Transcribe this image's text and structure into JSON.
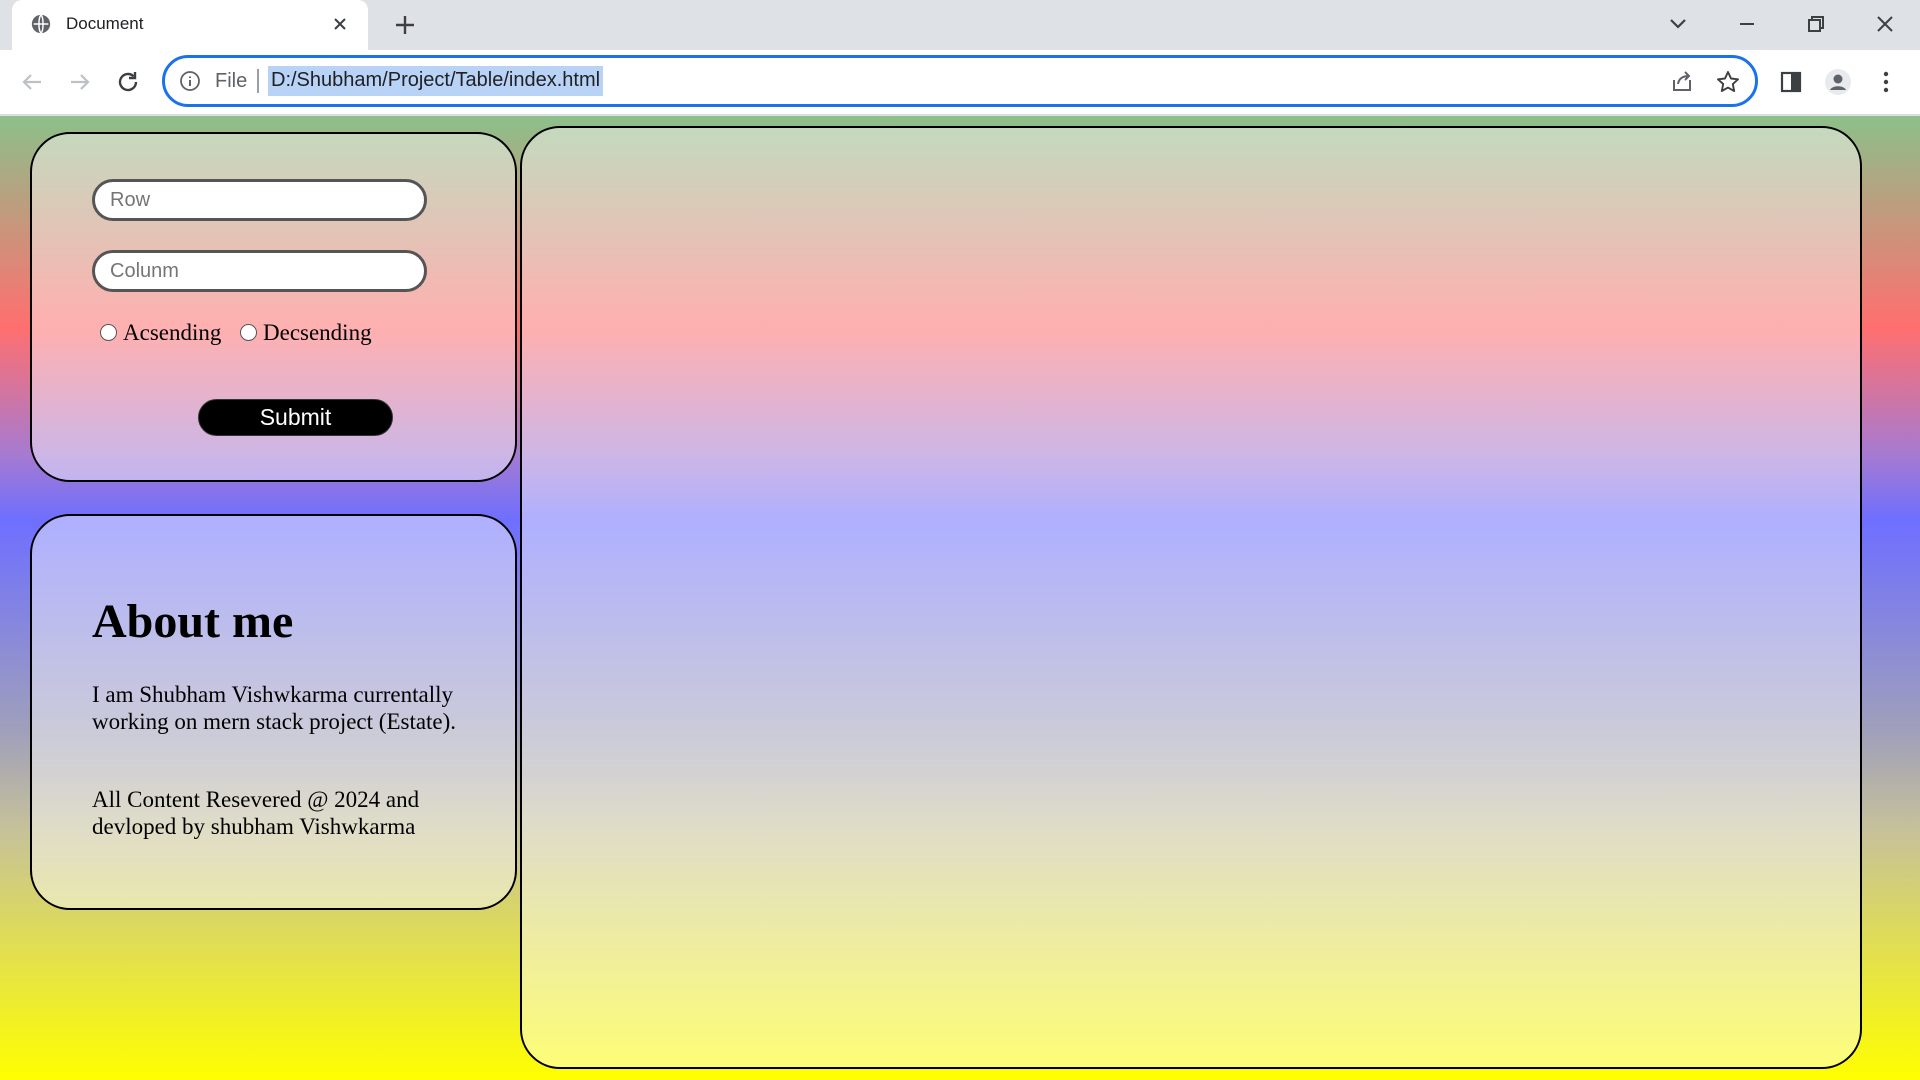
{
  "browser": {
    "tab_title": "Document",
    "address_prefix": "File",
    "url": "D:/Shubham/Project/Table/index.html"
  },
  "colors": {
    "omnibox_focus": "#1a73e8",
    "page_gradient": [
      "#8cc08a",
      "#ff6f6f",
      "#a77ad0",
      "#6e6fff",
      "#a0a0ba",
      "#c6c19a",
      "#ffff00"
    ]
  },
  "icons": {
    "tab_favicon": "globe-icon",
    "tab_close": "close-icon",
    "new_tab": "plus-icon",
    "tab_search": "chevron-down-icon",
    "minimize": "minimize-icon",
    "restore": "restore-icon",
    "close_window": "close-icon",
    "back": "back-arrow-icon",
    "forward": "forward-arrow-icon",
    "reload": "reload-icon",
    "site_info": "info-icon",
    "share": "share-icon",
    "bookmark": "star-icon",
    "side_panel": "side-panel-icon",
    "profile": "profile-icon",
    "menu": "kebab-menu-icon"
  },
  "form": {
    "row_placeholder": "Row",
    "column_placeholder": "Colunm",
    "sort_options": [
      {
        "label": "Acsending",
        "selected": false
      },
      {
        "label": "Decsending",
        "selected": false
      }
    ],
    "submit_label": "Submit"
  },
  "about": {
    "heading": "About me",
    "paragraphs": [
      "I am Shubham Vishwkarma currentally working on mern stack project (Estate).",
      "All Content Resevered @ 2024 and devloped by shubham Vishwkarma"
    ]
  }
}
